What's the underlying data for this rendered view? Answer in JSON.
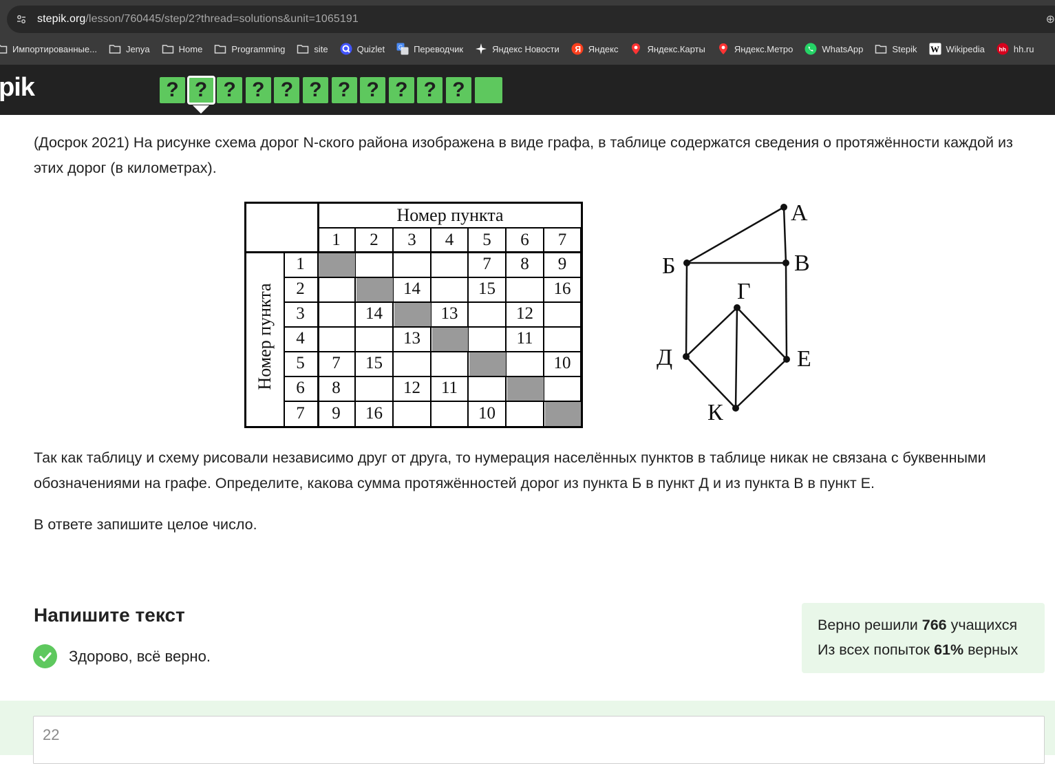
{
  "browser": {
    "url_host": "stepik.org",
    "url_path": "/lesson/760445/step/2?thread=solutions&unit=1065191",
    "bookmarks": [
      {
        "label": "Импортированные...",
        "icon": "folder-icon"
      },
      {
        "label": "Jenya",
        "icon": "folder-icon"
      },
      {
        "label": "Home",
        "icon": "folder-icon"
      },
      {
        "label": "Programming",
        "icon": "folder-icon"
      },
      {
        "label": "site",
        "icon": "folder-icon"
      },
      {
        "label": "Quizlet",
        "icon": "quizlet-icon"
      },
      {
        "label": "Переводчик",
        "icon": "translate-icon"
      },
      {
        "label": "Яндекс Новости",
        "icon": "yandex-news-icon"
      },
      {
        "label": "Яндекс",
        "icon": "yandex-icon"
      },
      {
        "label": "Яндекс.Карты",
        "icon": "map-pin-icon"
      },
      {
        "label": "Яндекс.Метро",
        "icon": "map-pin-icon"
      },
      {
        "label": "WhatsApp",
        "icon": "whatsapp-icon"
      },
      {
        "label": "Stepik",
        "icon": "folder-icon"
      },
      {
        "label": "Wikipedia",
        "icon": "wikipedia-icon"
      },
      {
        "label": "hh.ru",
        "icon": "hh-icon"
      }
    ]
  },
  "stepik": {
    "logo": "pik",
    "steps": [
      "?",
      "?",
      "?",
      "?",
      "?",
      "?",
      "?",
      "?",
      "?",
      "?",
      "?",
      ""
    ],
    "current_step_index": 1,
    "accent_color": "#5ec85e"
  },
  "problem": {
    "intro": "(Досрок 2021) На рисунке схема дорог N-ского района изображена в виде графа, в таблице содержатся сведения о протяжённости каждой из этих дорог (в километрах).",
    "body": "Так как таблицу и схему рисовали независимо друг от друга, то нумерация населённых пунктов в таблице никак не связана с буквенными обозначениями на графе. Определите, какова сумма протяжённостей дорог из пункта Б в пункт Д и из пункта В в пункт Е.",
    "instruction": "В ответе запишите целое число."
  },
  "table": {
    "col_header": "Номер пункта",
    "row_header": "Номер пункта",
    "headers": [
      "1",
      "2",
      "3",
      "4",
      "5",
      "6",
      "7"
    ],
    "rows": [
      [
        "",
        "",
        "",
        "",
        "7",
        "8",
        "9"
      ],
      [
        "",
        "",
        "14",
        "",
        "15",
        "",
        "16"
      ],
      [
        "",
        "14",
        "",
        "13",
        "",
        "12",
        ""
      ],
      [
        "",
        "",
        "13",
        "",
        "",
        "11",
        ""
      ],
      [
        "7",
        "15",
        "",
        "",
        "",
        "",
        "10"
      ],
      [
        "8",
        "",
        "12",
        "11",
        "",
        "",
        ""
      ],
      [
        "9",
        "16",
        "",
        "",
        "10",
        "",
        ""
      ]
    ]
  },
  "graph": {
    "labels": {
      "A": "А",
      "B": "Б",
      "V": "В",
      "G": "Г",
      "D": "Д",
      "E": "Е",
      "K": "К"
    }
  },
  "answer_section": {
    "title": "Напишите текст",
    "success_text": "Здорово, всё верно.",
    "stats": {
      "line1_prefix": "Верно решили ",
      "line1_count": "766",
      "line1_suffix": " учащихся",
      "line2_prefix": "Из всех попыток ",
      "line2_percent": "61%",
      "line2_suffix": " верных"
    },
    "answer_value": "22"
  }
}
